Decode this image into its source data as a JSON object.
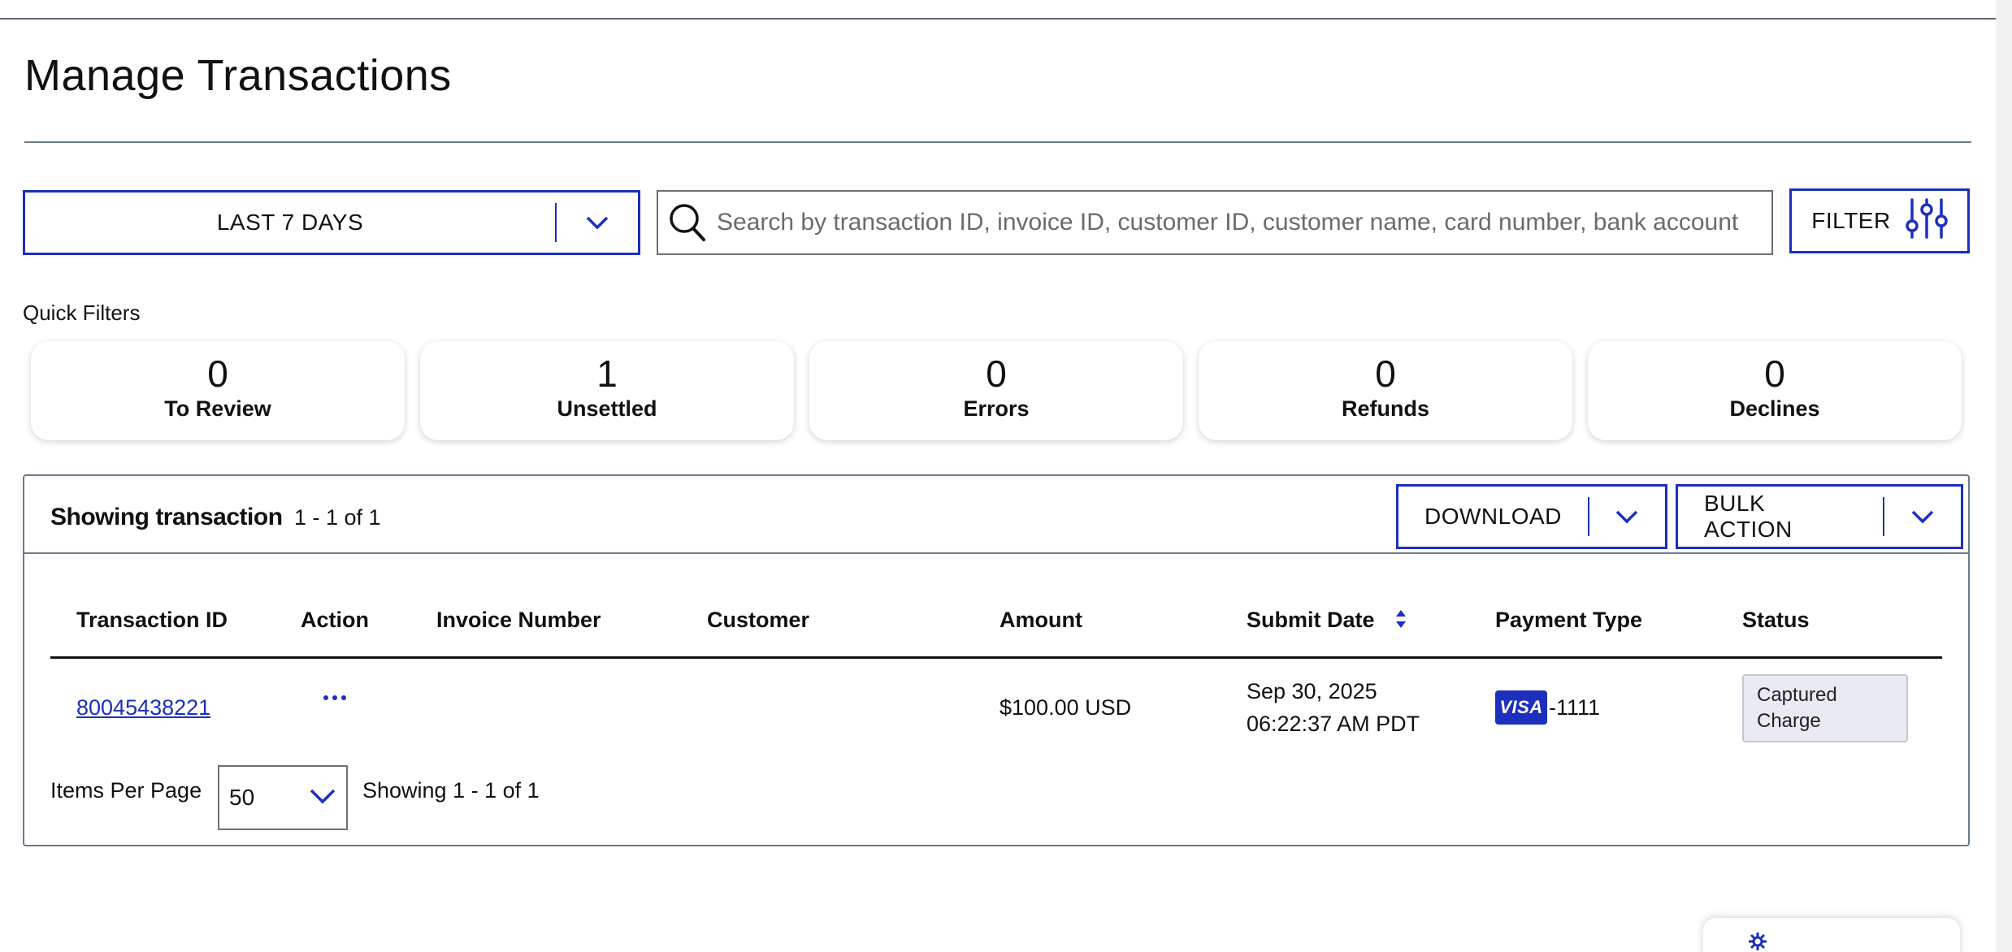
{
  "page": {
    "title": "Manage Transactions"
  },
  "toolbar": {
    "date_range": "LAST 7 DAYS",
    "search_placeholder": "Search by transaction ID, invoice ID, customer ID, customer name, card number, bank account",
    "filter_label": "FILTER"
  },
  "quick_filters": {
    "title": "Quick Filters",
    "items": [
      {
        "count": "0",
        "label": "To Review"
      },
      {
        "count": "1",
        "label": "Unsettled"
      },
      {
        "count": "0",
        "label": "Errors"
      },
      {
        "count": "0",
        "label": "Refunds"
      },
      {
        "count": "0",
        "label": "Declines"
      }
    ]
  },
  "table": {
    "showing_title": "Showing transaction",
    "showing_range": "1 - 1 of 1",
    "download_label": "DOWNLOAD",
    "bulk_action_label": "BULK ACTION",
    "columns": [
      "Transaction ID",
      "Action",
      "Invoice Number",
      "Customer",
      "Amount",
      "Submit Date",
      "Payment Type",
      "Status"
    ],
    "rows": [
      {
        "transaction_id": "80045438221",
        "invoice_number": "",
        "customer": "",
        "amount": "$100.00 USD",
        "submit_date": "Sep 30, 2025",
        "submit_time": "06:22:37 AM PDT",
        "card_brand": "VISA",
        "card_last4": "-1111",
        "status_line1": "Captured",
        "status_line2": "Charge"
      }
    ],
    "sort_column": "Submit Date"
  },
  "pagination": {
    "items_per_page_label": "Items Per Page",
    "items_per_page": "50",
    "showing": "Showing 1 - 1 of 1"
  },
  "colors": {
    "accent": "#1c2fbd",
    "border": "#6a7a8c",
    "badge_bg": "#e9eaf2"
  }
}
